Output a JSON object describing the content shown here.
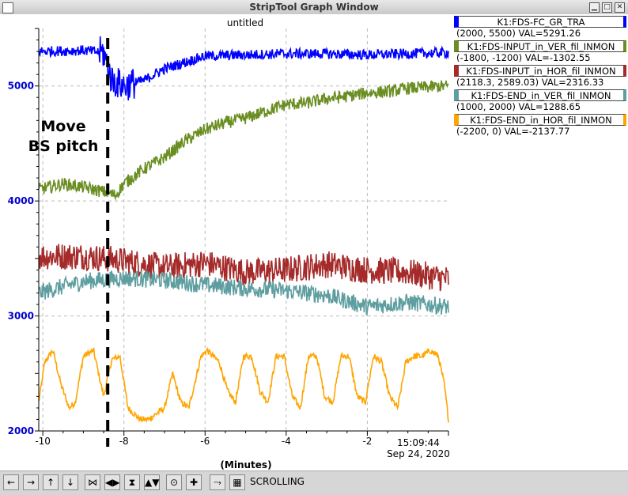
{
  "window": {
    "title": "StripTool Graph Window",
    "min_glyph": "▁",
    "max_glyph": "□",
    "close_glyph": "✕"
  },
  "toolbar": {
    "status": "SCROLLING",
    "buttons": [
      {
        "name": "pan-left-button",
        "glyph": "←"
      },
      {
        "name": "pan-right-button",
        "glyph": "→"
      },
      {
        "name": "pan-up-button",
        "glyph": "↑"
      },
      {
        "name": "pan-down-button",
        "glyph": "↓"
      },
      {
        "name": "zoom-in-x-button",
        "glyph": "⋈"
      },
      {
        "name": "zoom-out-x-button",
        "glyph": "◀▶"
      },
      {
        "name": "zoom-in-y-button",
        "glyph": "⧗"
      },
      {
        "name": "zoom-out-y-button",
        "glyph": "▲▼"
      },
      {
        "name": "auto-scale-button",
        "glyph": "⊙"
      },
      {
        "name": "reset-button",
        "glyph": "✚"
      },
      {
        "name": "refresh-button",
        "glyph": "⤳"
      },
      {
        "name": "scroll-button",
        "glyph": "▦"
      }
    ]
  },
  "annotation": {
    "line1": "Move",
    "line2": "BS pitch",
    "x": -8.4
  },
  "legend": [
    {
      "name": "K1:FDS-FC_GR_TRA",
      "range": "(2000, 5500) VAL=5291.26",
      "color": "#0000ff"
    },
    {
      "name": "K1:FDS-INPUT_in_VER_fil_INMON",
      "range": "(-1800, -1200) VAL=-1302.55",
      "color": "#6b8e23"
    },
    {
      "name": "K1:FDS-INPUT_in_HOR_fil_INMON",
      "range": "(2118.3, 2589.03) VAL=2316.33",
      "color": "#a52a2a"
    },
    {
      "name": "K1:FDS-END_in_VER_fil_INMON",
      "range": "(1000, 2000) VAL=1288.65",
      "color": "#5f9ea0"
    },
    {
      "name": "K1:FDS-END_in_HOR_fil_INMON",
      "range": "(-2200, 0) VAL=-2137.77",
      "color": "#ffa500"
    }
  ],
  "chart_data": {
    "type": "line",
    "title": "untitled",
    "xlabel": "(Minutes)",
    "time_label": "15:09:44",
    "date_label": "Sep 24, 2020",
    "xlim": [
      -10.1,
      0
    ],
    "ylim": [
      2000,
      5500
    ],
    "x_ticks": [
      -10,
      -8,
      -6,
      -4,
      -2
    ],
    "y_ticks": [
      2000,
      3000,
      4000,
      5000
    ],
    "grid": true,
    "series": [
      {
        "color": "#0000ff",
        "x": [
          -10.1,
          -9,
          -8.5,
          -8.3,
          -8,
          -7.5,
          -7,
          -6,
          -5,
          -4,
          -3,
          -2,
          -1,
          0
        ],
        "y": [
          5300,
          5310,
          5290,
          5050,
          5000,
          5050,
          5150,
          5260,
          5270,
          5280,
          5280,
          5270,
          5280,
          5290
        ],
        "noise": 45
      },
      {
        "color": "#6b8e23",
        "x": [
          -10.1,
          -9.5,
          -9,
          -8.5,
          -8.2,
          -8,
          -7.5,
          -7,
          -6.5,
          -6,
          -5.5,
          -5,
          -4.5,
          -4,
          -3.5,
          -3,
          -2.5,
          -2,
          -1.5,
          -1,
          -0.5,
          0
        ],
        "y": [
          4100,
          4150,
          4120,
          4080,
          4050,
          4150,
          4280,
          4380,
          4520,
          4620,
          4680,
          4720,
          4780,
          4840,
          4850,
          4890,
          4910,
          4940,
          4950,
          4980,
          4990,
          5000
        ],
        "noise": 55
      },
      {
        "color": "#a52a2a",
        "x": [
          -10.1,
          -9,
          -8,
          -7,
          -6,
          -5,
          -4,
          -3,
          -2,
          -1,
          0
        ],
        "y": [
          3520,
          3520,
          3480,
          3420,
          3460,
          3380,
          3400,
          3450,
          3400,
          3380,
          3320
        ],
        "noise": 120
      },
      {
        "color": "#5f9ea0",
        "x": [
          -10.1,
          -9,
          -8,
          -7,
          -6,
          -5,
          -4,
          -3,
          -2,
          -1,
          0
        ],
        "y": [
          3200,
          3300,
          3330,
          3310,
          3270,
          3240,
          3220,
          3180,
          3080,
          3120,
          3080
        ],
        "noise": 75
      },
      {
        "color": "#ffa500",
        "x": [
          -10.1,
          -9.95,
          -9.75,
          -9.55,
          -9.35,
          -9.2,
          -9.0,
          -8.75,
          -8.5,
          -8.3,
          -8.1,
          -7.9,
          -7.6,
          -7.4,
          -7.2,
          -7.0,
          -6.8,
          -6.6,
          -6.4,
          -6.1,
          -5.95,
          -5.8,
          -5.65,
          -5.45,
          -5.25,
          -5.05,
          -4.85,
          -4.65,
          -4.45,
          -4.25,
          -4.05,
          -3.85,
          -3.65,
          -3.45,
          -3.25,
          -3.05,
          -2.85,
          -2.65,
          -2.45,
          -2.25,
          -2.05,
          -1.85,
          -1.65,
          -1.45,
          -1.25,
          -1.05,
          -0.85,
          -0.65,
          -0.45,
          -0.25,
          -0.1,
          0
        ],
        "y": [
          2250,
          2600,
          2700,
          2400,
          2200,
          2250,
          2650,
          2700,
          2300,
          2620,
          2650,
          2200,
          2100,
          2100,
          2150,
          2200,
          2500,
          2250,
          2200,
          2650,
          2700,
          2650,
          2600,
          2350,
          2250,
          2650,
          2650,
          2350,
          2250,
          2650,
          2650,
          2300,
          2200,
          2650,
          2650,
          2300,
          2250,
          2650,
          2650,
          2300,
          2250,
          2650,
          2600,
          2300,
          2200,
          2600,
          2650,
          2650,
          2700,
          2650,
          2400,
          2100
        ],
        "noise": 28
      }
    ]
  }
}
